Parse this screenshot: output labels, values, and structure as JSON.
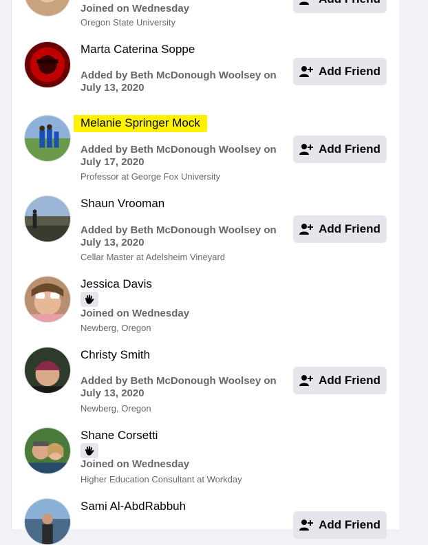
{
  "button_label": "Add Friend",
  "members": [
    {
      "name": "",
      "line1": "Joined on Wednesday",
      "line2": "Oregon State University"
    },
    {
      "name": "Marta Caterina Soppe",
      "line1": "Added by Beth McDonough Woolsey on July 13, 2020",
      "line2": ""
    },
    {
      "name": "Melanie Springer Mock",
      "line1": "Added by Beth McDonough Woolsey on July 17, 2020",
      "line2": "Professor at George Fox University"
    },
    {
      "name": "Shaun Vrooman",
      "line1": "Added by Beth McDonough Woolsey on July 13, 2020",
      "line2": "Cellar Master at Adelsheim Vineyard"
    },
    {
      "name": "Jessica Davis",
      "line1": "Joined on Wednesday",
      "line2": "Newberg, Oregon"
    },
    {
      "name": "Christy Smith",
      "line1": "Added by Beth McDonough Woolsey on July 13, 2020",
      "line2": "Newberg, Oregon"
    },
    {
      "name": "Shane Corsetti",
      "line1": "Joined on Wednesday",
      "line2": "Higher Education Consultant at Workday"
    },
    {
      "name": "Sami Al-AbdRabbuh",
      "line1": "",
      "line2": ""
    }
  ],
  "colors": {
    "page_bg": "#f0f2f5",
    "card_bg": "#ffffff",
    "button_bg": "#e4e6eb",
    "highlight": "#fff200",
    "secondary_text": "#65676b"
  },
  "icons": {
    "add_friend": "person-plus-icon",
    "wave": "waving-hand-icon"
  }
}
